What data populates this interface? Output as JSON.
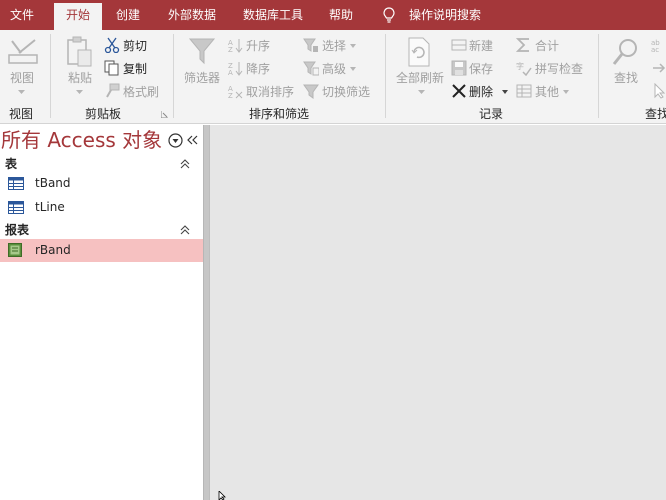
{
  "tabs": [
    {
      "label": "文件"
    },
    {
      "label": "开始"
    },
    {
      "label": "创建"
    },
    {
      "label": "外部数据"
    },
    {
      "label": "数据库工具"
    },
    {
      "label": "帮助"
    }
  ],
  "tell_me": {
    "label": "操作说明搜索",
    "icon": "lightbulb-icon"
  },
  "ribbon": {
    "views": {
      "view_label": "视图",
      "group_label": "视图"
    },
    "clipboard": {
      "paste_label": "粘贴",
      "cut_label": "剪切",
      "copy_label": "复制",
      "format_painter_label": "格式刷",
      "group_label": "剪贴板"
    },
    "sort_filter": {
      "filter_label": "筛选器",
      "ascending_label": "升序",
      "descending_label": "降序",
      "remove_sort_label": "取消排序",
      "selection_label": "选择",
      "advanced_label": "高级",
      "toggle_filter_label": "切换筛选",
      "group_label": "排序和筛选"
    },
    "records": {
      "refresh_all_label": "全部刷新",
      "new_label": "新建",
      "save_label": "保存",
      "delete_label": "删除",
      "totals_label": "合计",
      "spelling_label": "拼写检查",
      "more_label": "其他",
      "group_label": "记录"
    },
    "find": {
      "find_label": "查找",
      "group_label": "查找"
    }
  },
  "nav_pane": {
    "title": "所有 Access 对象",
    "groups": [
      {
        "label": "表",
        "items": [
          {
            "label": "tBand"
          },
          {
            "label": "tLine"
          }
        ]
      },
      {
        "label": "报表",
        "items": [
          {
            "label": "rBand"
          }
        ]
      }
    ]
  },
  "colors": {
    "accent": "#a4373a",
    "selection": "#f6c1c1",
    "workspace": "#e6e6e6"
  }
}
